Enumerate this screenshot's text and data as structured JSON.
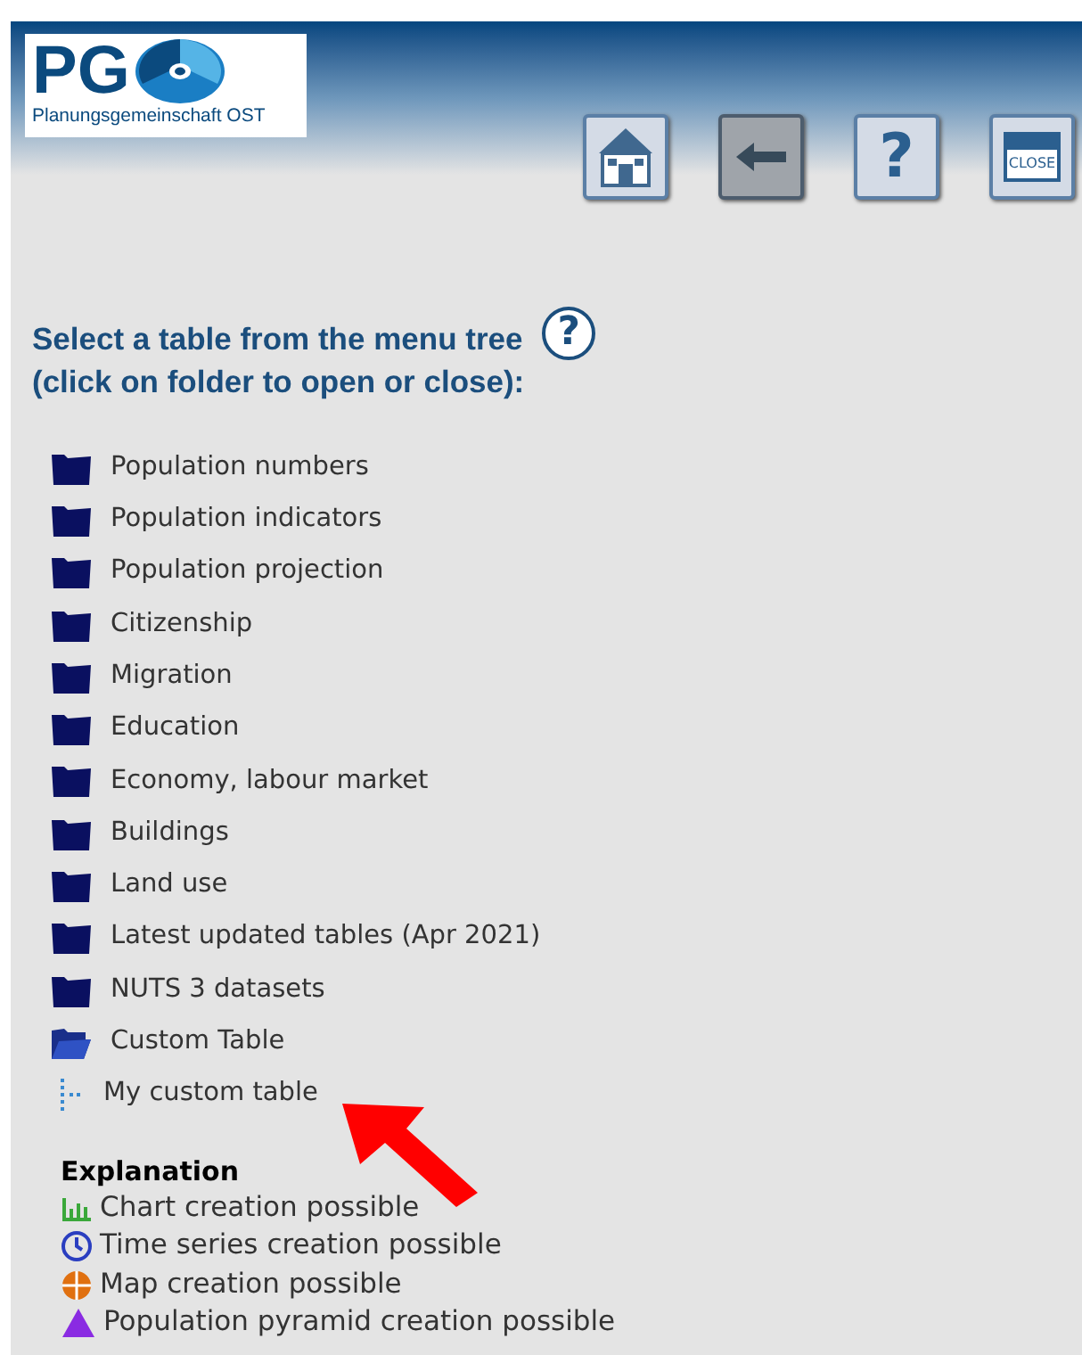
{
  "header": {
    "logo": {
      "letters": "PG",
      "subtitle": "Planungsgemeinschaft OST"
    },
    "buttons": [
      {
        "kind": "home"
      },
      {
        "kind": "back"
      },
      {
        "kind": "help",
        "label": "?"
      },
      {
        "kind": "close",
        "label": "CLOSE"
      }
    ]
  },
  "heading": {
    "lines": [
      "Select a table from the menu tree",
      "(click on folder to open or close):"
    ],
    "help_icon": "?"
  },
  "tree": [
    {
      "label": "Population numbers",
      "expanded": false
    },
    {
      "label": "Population indicators",
      "expanded": false
    },
    {
      "label": "Population projection",
      "expanded": false
    },
    {
      "label": "Citizenship",
      "expanded": false
    },
    {
      "label": "Migration",
      "expanded": false
    },
    {
      "label": "Education",
      "expanded": false
    },
    {
      "label": "Economy, labour market",
      "expanded": false
    },
    {
      "label": "Buildings",
      "expanded": false
    },
    {
      "label": "Land use",
      "expanded": false
    },
    {
      "label": "Latest updated tables (Apr 2021)",
      "expanded": false
    },
    {
      "label": "NUTS 3 datasets",
      "expanded": false
    },
    {
      "label": "Custom Table",
      "expanded": true,
      "children": [
        {
          "label": "My custom table"
        }
      ]
    }
  ],
  "explanation": {
    "title": "Explanation",
    "items": [
      {
        "kind": "chart",
        "label": "Chart creation possible"
      },
      {
        "kind": "timeseries",
        "label": "Time series creation possible"
      },
      {
        "kind": "map",
        "label": "Map creation possible"
      },
      {
        "kind": "pyramid",
        "label": "Population pyramid creation possible"
      }
    ]
  }
}
